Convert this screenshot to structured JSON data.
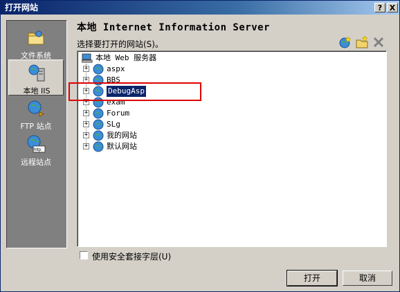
{
  "window": {
    "title": "打开网站",
    "help_glyph": "?",
    "close_glyph": "X"
  },
  "sidebar": {
    "items": [
      {
        "label": "文件系统",
        "icon": "folder-icon",
        "active": false
      },
      {
        "label": "本地 IIS",
        "icon": "iis-server-icon",
        "active": true
      },
      {
        "label": "FTP 站点",
        "icon": "ftp-globe-icon",
        "active": false
      },
      {
        "label": "远程站点",
        "icon": "http-globe-icon",
        "active": false
      }
    ]
  },
  "main": {
    "heading": "本地 Internet Information Server",
    "instruction": "选择要打开的网站(S)。",
    "toolbar": [
      "new-site-icon",
      "new-folder-icon",
      "delete-icon"
    ]
  },
  "tree": {
    "root": "本地 Web 服务器",
    "nodes": [
      {
        "label": "aspx",
        "selected": false
      },
      {
        "label": "BBS",
        "selected": false
      },
      {
        "label": "DebugAsp",
        "selected": true
      },
      {
        "label": "exam",
        "selected": false
      },
      {
        "label": "Forum",
        "selected": false
      },
      {
        "label": "SLg",
        "selected": false
      },
      {
        "label": "我的网站",
        "selected": false
      },
      {
        "label": "默认网站",
        "selected": false
      }
    ],
    "expand_glyph": "+"
  },
  "options": {
    "ssl_label": "使用安全套接字层(U)",
    "ssl_checked": false
  },
  "buttons": {
    "open": "打开",
    "cancel": "取消"
  },
  "colors": {
    "selection": "#0a246a",
    "highlight_box": "#e00000"
  }
}
